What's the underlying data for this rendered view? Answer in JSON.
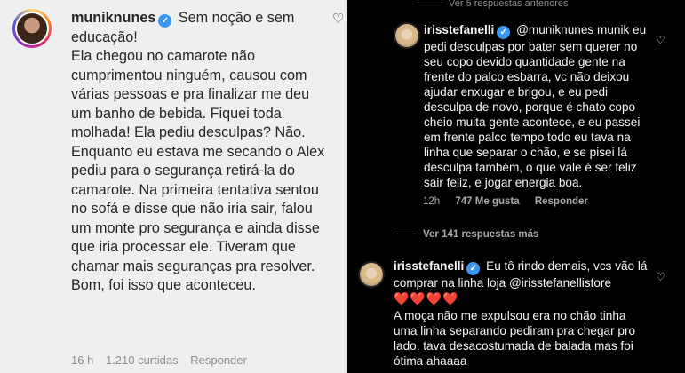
{
  "left": {
    "username": "muniknunes",
    "lead": "Sem noção e sem educação!",
    "body": "Ela chegou no camarote não cumprimentou ninguém, causou com várias pessoas e pra finalizar me deu um banho de bebida. Fiquei toda molhada! Ela pediu desculpas? Não.",
    "body2": "Enquanto eu estava me secando o Alex pediu para o segurança retirá-la do camarote. Na primeira tentativa sentou no sofá e disse que não iria sair, falou um monte pro segurança e ainda disse que iria processar ele. Tiveram que chamar mais seguranças pra resolver. Bom, foi isso que aconteceu.",
    "time": "16 h",
    "likes": "1.210 curtidas",
    "reply": "Responder"
  },
  "right": {
    "top_link": "Ver 5 respuestas anteriores",
    "comment1": {
      "username": "irisstefanelli",
      "text": "@muniknunes munik eu pedi desculpas por bater sem querer no seu copo devido quantidade gente na frente do palco esbarra, vc não deixou ajudar enxugar e brigou, e eu pedi desculpa de novo, porque é chato copo cheio muita gente acontece, e eu passei em frente palco tempo todo eu tava na linha que separar o chão, e se pisei lá desculpa também, o que vale é ser feliz sair feliz, e jogar energia boa.",
      "time": "12h",
      "likes": "747 Me gusta",
      "reply": "Responder"
    },
    "more_replies": "Ver 141 respuestas más",
    "comment2": {
      "username": "irisstefanelli",
      "text": "Eu tô rindo demais, vcs vão lá comprar na linha loja @irisstefanellistore",
      "hearts": "❤️❤️❤️❤️",
      "text2": "A moça não me expulsou era no chão tinha uma linha separando pediram pra chegar pro lado, tava desacostumada de balada mas foi ótima ahaaaa"
    }
  }
}
